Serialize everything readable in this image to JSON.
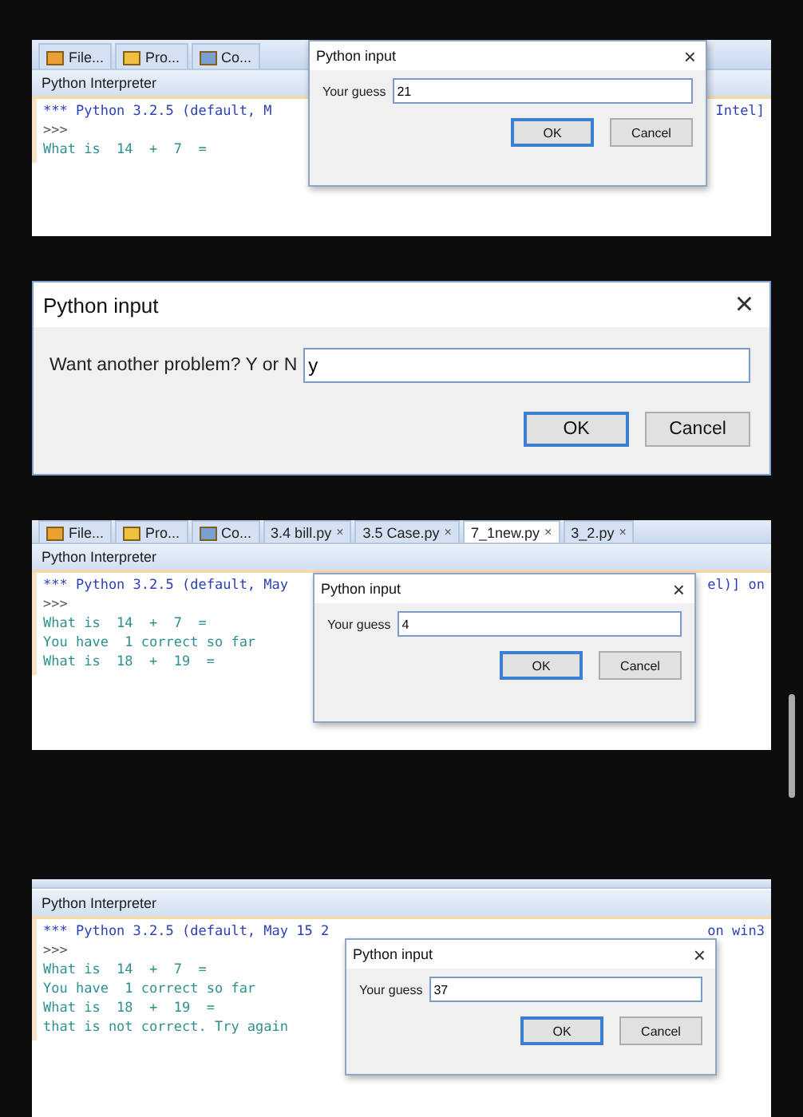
{
  "panels": [
    {
      "kind": "ide",
      "tabs": [
        {
          "kind": "tool",
          "label": "File...",
          "selected": false
        },
        {
          "kind": "tool",
          "label": "Pro...",
          "selected": false
        },
        {
          "kind": "tool",
          "label": "Co...",
          "selected": false
        }
      ],
      "pane_title": "Python Interpreter",
      "console": [
        {
          "kind": "banner",
          "text": "*** Python 3.2.5 (default, M",
          "tail": "Intel]"
        },
        {
          "kind": "prompt",
          "text": ">>>"
        },
        {
          "kind": "output",
          "text": "What is  14  +  7  ="
        }
      ],
      "dialog": {
        "title": "Python input",
        "close": "×",
        "label": "Your guess",
        "value": "21",
        "buttons": [
          {
            "label": "OK",
            "default": true
          },
          {
            "label": "Cancel",
            "default": false
          }
        ]
      }
    },
    {
      "kind": "dialog",
      "dialog": {
        "title": "Python input",
        "close": "×",
        "label": "Want another problem? Y or N",
        "value": "y",
        "buttons": [
          {
            "label": "OK",
            "default": true
          },
          {
            "label": "Cancel",
            "default": false
          }
        ]
      }
    },
    {
      "kind": "ide",
      "tabs": [
        {
          "kind": "tool",
          "label": "File...",
          "selected": false
        },
        {
          "kind": "tool",
          "label": "Pro...",
          "selected": false
        },
        {
          "kind": "tool",
          "label": "Co...",
          "selected": false
        },
        {
          "kind": "file",
          "label": "3.4 bill.py",
          "close": "×",
          "selected": false
        },
        {
          "kind": "file",
          "label": "3.5 Case.py",
          "close": "×",
          "selected": false
        },
        {
          "kind": "file",
          "label": "7_1new.py",
          "close": "×",
          "selected": true
        },
        {
          "kind": "file",
          "label": "3_2.py",
          "close": "×",
          "selected": false
        }
      ],
      "pane_title": "Python Interpreter",
      "console": [
        {
          "kind": "banner",
          "text": "*** Python 3.2.5 (default, May",
          "tail": "el)] on"
        },
        {
          "kind": "prompt",
          "text": ">>>"
        },
        {
          "kind": "output",
          "text": "What is  14  +  7  ="
        },
        {
          "kind": "output",
          "text": "You have  1 correct so far"
        },
        {
          "kind": "output",
          "text": "What is  18  +  19  ="
        }
      ],
      "dialog": {
        "title": "Python input",
        "close": "×",
        "label": "Your guess",
        "value": "4",
        "buttons": [
          {
            "label": "OK",
            "default": true
          },
          {
            "label": "Cancel",
            "default": false
          }
        ]
      }
    },
    {
      "kind": "ide",
      "pane_title": "Python Interpreter",
      "console": [
        {
          "kind": "banner",
          "text": "*** Python 3.2.5 (default, May 15 2",
          "tail": "on win3"
        },
        {
          "kind": "prompt",
          "text": ">>>"
        },
        {
          "kind": "output",
          "text": "What is  14  +  7  ="
        },
        {
          "kind": "output",
          "text": "You have  1 correct so far"
        },
        {
          "kind": "output",
          "text": "What is  18  +  19  ="
        },
        {
          "kind": "output",
          "text": "that is not correct. Try again"
        }
      ],
      "dialog": {
        "title": "Python input",
        "close": "×",
        "label": "Your guess",
        "value": "37",
        "buttons": [
          {
            "label": "OK",
            "default": true
          },
          {
            "label": "Cancel",
            "default": false
          }
        ]
      }
    }
  ]
}
